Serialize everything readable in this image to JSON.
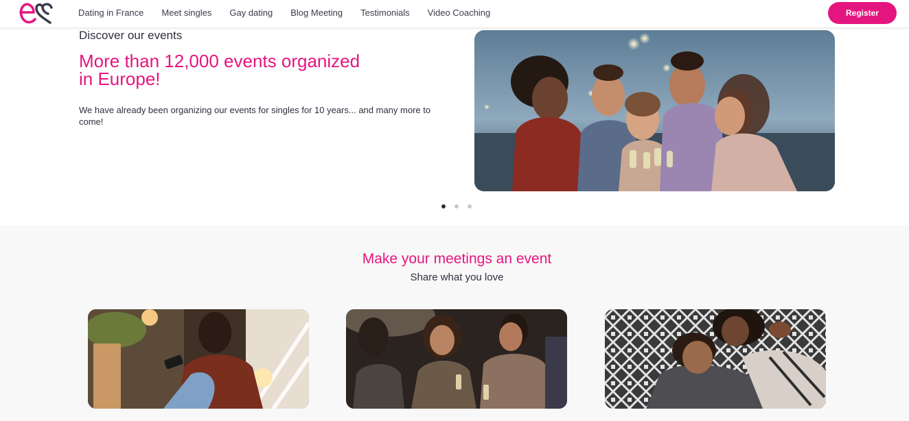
{
  "header": {
    "nav": [
      "Dating in France",
      "Meet singles",
      "Gay dating",
      "Blog Meeting",
      "Testimonials",
      "Video Coaching"
    ],
    "register_label": "Register"
  },
  "hero": {
    "eyebrow": "Discover our events",
    "title": "More than 12,000 events organized in Europe!",
    "text": "We have already been organizing our events for singles for 10 years... and many more to come!",
    "carousel": {
      "slides": 3,
      "active": 1
    }
  },
  "section": {
    "title": "Make your meetings an event",
    "subtitle": "Share what you love"
  },
  "colors": {
    "brand": "#e5157f",
    "text": "#2d2f3e",
    "section_bg": "#f8f8f8"
  },
  "icons": {
    "logo": "es-heart-logo"
  }
}
